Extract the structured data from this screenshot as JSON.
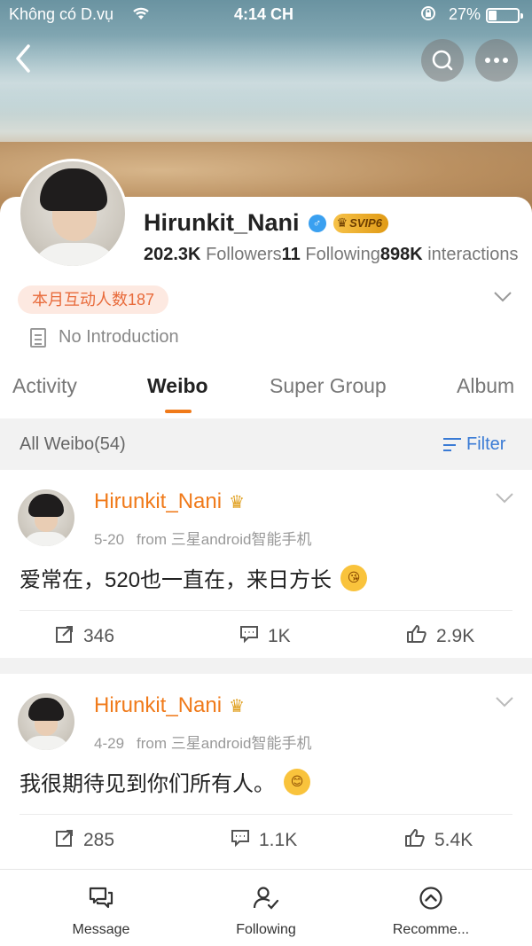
{
  "statusbar": {
    "carrier": "Không có D.vụ",
    "time": "4:14 CH",
    "battery": "27%",
    "battery_level": 0.27
  },
  "profile": {
    "username": "Hirunkit_Nani",
    "gender_symbol": "♂",
    "vip_badge": "SVIP6",
    "followers_count": "202.3K",
    "followers_label": "Followers",
    "following_count": "11",
    "following_label": "Following",
    "interactions_count": "898K",
    "interactions_label": "interactions",
    "monthly_badge": "本月互动人数187",
    "intro": "No Introduction"
  },
  "tabs": [
    {
      "label": "Activity"
    },
    {
      "label": "Weibo"
    },
    {
      "label": "Super Group"
    },
    {
      "label": "Album"
    }
  ],
  "filter_bar": {
    "all_label": "All Weibo(54)",
    "filter_label": "Filter"
  },
  "posts": [
    {
      "author": "Hirunkit_Nani",
      "date": "5-20",
      "source": "from 三星android智能手机",
      "text": "爱常在，520也一直在，来日方长",
      "reposts": "346",
      "comments": "1K",
      "likes": "2.9K"
    },
    {
      "author": "Hirunkit_Nani",
      "date": "4-29",
      "source": "from 三星android智能手机",
      "text": "我很期待见到你们所有人。",
      "reposts": "285",
      "comments": "1.1K",
      "likes": "5.4K"
    }
  ],
  "bottom_nav": [
    {
      "label": "Message",
      "icon": "message-icon"
    },
    {
      "label": "Following",
      "icon": "follow-user-icon"
    },
    {
      "label": "Recomme...",
      "icon": "recommend-icon"
    }
  ],
  "colors": {
    "accent": "#f07a1a",
    "link": "#3a7bd5",
    "badge_bg": "#fde9e1",
    "badge_text": "#e86a3a"
  }
}
